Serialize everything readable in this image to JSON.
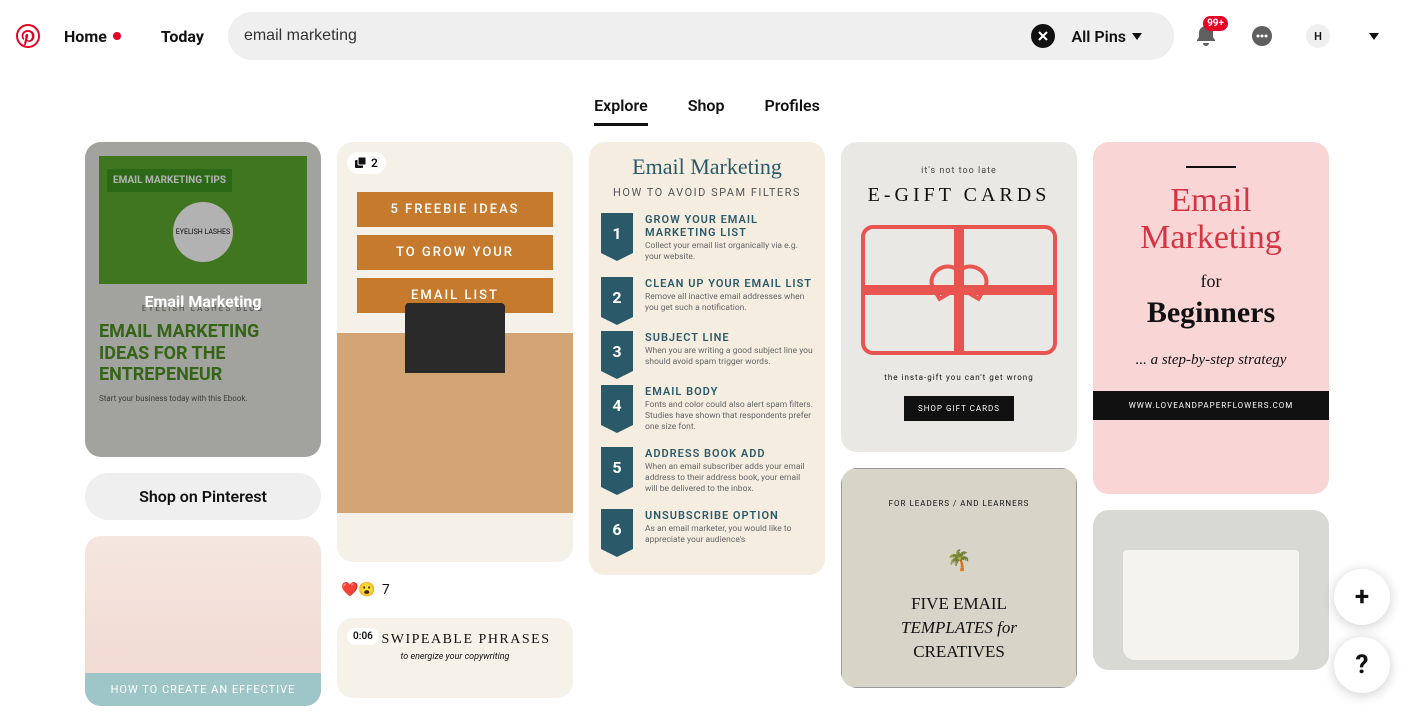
{
  "header": {
    "home": "Home",
    "today": "Today",
    "search_value": "email marketing",
    "allpins": "All Pins",
    "badge": "99+",
    "avatar": "H"
  },
  "tabs": [
    {
      "label": "Explore",
      "active": true
    },
    {
      "label": "Shop",
      "active": false
    },
    {
      "label": "Profiles",
      "active": false
    }
  ],
  "col1": {
    "pin1": {
      "tip_badge": "EMAIL MARKETING TIPS",
      "circle": "EYELISH LASHES",
      "blog": "EYELISH LASHES  BLOG",
      "main": "EMAIL MARKETING IDEAS FOR THE ENTREPENEUR",
      "sub": "Start your business today with this Ebook.",
      "overlay": "Email Marketing"
    },
    "shop_btn": "Shop on Pinterest",
    "flat_banner": "HOW TO CREATE AN EFFECTIVE"
  },
  "col2": {
    "pin2": {
      "count": "2",
      "line1": "5 FREEBIE IDEAS",
      "line2": "TO GROW YOUR",
      "line3": "EMAIL LIST"
    },
    "reactions": {
      "emoji": "❤️😮",
      "count": "7"
    },
    "swipe": {
      "duration": "0:06",
      "title": "16 SWIPEABLE PHRASES",
      "sub": "to energize your copywriting"
    }
  },
  "col3": {
    "title": "Email Marketing",
    "subtitle": "HOW TO AVOID SPAM FILTERS",
    "items": [
      {
        "n": "1",
        "h": "GROW YOUR EMAIL MARKETING LIST",
        "d": "Collect your email list organically via e.g. your website."
      },
      {
        "n": "2",
        "h": "CLEAN UP YOUR EMAIL LIST",
        "d": "Remove all inactive email addresses when you get such a notification."
      },
      {
        "n": "3",
        "h": "SUBJECT LINE",
        "d": "When you are writing a good subject line you should avoid spam trigger words."
      },
      {
        "n": "4",
        "h": "EMAIL BODY",
        "d": "Fonts and color could also alert spam filters. Studies have shown that respondents prefer one size font."
      },
      {
        "n": "5",
        "h": "ADDRESS BOOK ADD",
        "d": "When an email subscriber adds your email address to their address book, your email will be delivered to the inbox."
      },
      {
        "n": "6",
        "h": "UNSUBSCRIBE OPTION",
        "d": "As an email marketer, you would like to appreciate your audience's"
      }
    ]
  },
  "col4": {
    "egift": {
      "top": "it's not too late",
      "title": "E-GIFT CARDS",
      "tag": "the insta-gift you can't get wrong",
      "btn": "SHOP GIFT CARDS"
    },
    "tmpl": {
      "top": "FOR LEADERS / AND LEARNERS",
      "title_1": "FIVE EMAIL",
      "title_2": "TEMPLATES for",
      "title_3": "CREATIVES"
    }
  },
  "col5": {
    "beg": {
      "title": "Email Marketing",
      "for": "for",
      "main": "Beginners",
      "step": "... a step-by-step strategy",
      "foot": "WWW.LOVEANDPAPERFLOWERS.COM"
    }
  }
}
